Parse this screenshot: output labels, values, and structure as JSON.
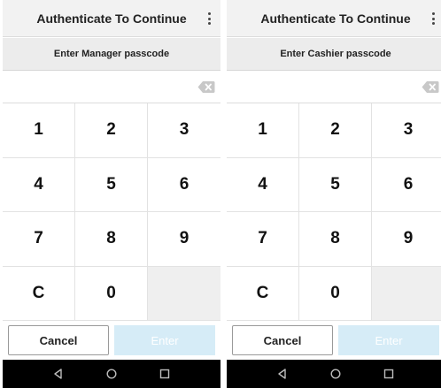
{
  "screens": [
    {
      "appbar": {
        "title": "Authenticate To Continue",
        "menu_icon": "more-vert-icon"
      },
      "prompt": "Enter Manager passcode",
      "passcode": {
        "value": "",
        "backspace_icon": "backspace-icon"
      },
      "keypad": {
        "keys": [
          "1",
          "2",
          "3",
          "4",
          "5",
          "6",
          "7",
          "8",
          "9",
          "C",
          "0",
          ""
        ]
      },
      "actions": {
        "cancel_label": "Cancel",
        "enter_label": "Enter"
      },
      "navbar": {
        "icons": [
          "back-icon",
          "home-icon",
          "recents-icon"
        ]
      }
    },
    {
      "appbar": {
        "title": "Authenticate To Continue",
        "menu_icon": "more-vert-icon"
      },
      "prompt": "Enter Cashier passcode",
      "passcode": {
        "value": "",
        "backspace_icon": "backspace-icon"
      },
      "keypad": {
        "keys": [
          "1",
          "2",
          "3",
          "4",
          "5",
          "6",
          "7",
          "8",
          "9",
          "C",
          "0",
          ""
        ]
      },
      "actions": {
        "cancel_label": "Cancel",
        "enter_label": "Enter"
      },
      "navbar": {
        "icons": [
          "back-icon",
          "home-icon",
          "recents-icon"
        ]
      }
    }
  ],
  "colors": {
    "appbar_bg": "#f2f2f2",
    "prompt_bg": "#ececec",
    "enter_disabled_bg": "#d6ecf7",
    "navbar_bg": "#000000"
  }
}
